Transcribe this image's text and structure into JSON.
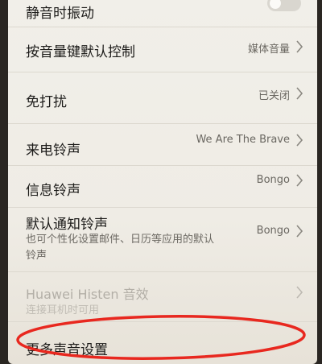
{
  "settings": {
    "vibrate_silent": {
      "title": "静音时振动"
    },
    "volume_key": {
      "title": "按音量键默认控制",
      "value": "媒体音量"
    },
    "dnd": {
      "title": "免打扰",
      "value": "已关闭"
    },
    "ringtone": {
      "title": "来电铃声",
      "value": "We Are The Brave"
    },
    "message_tone": {
      "title": "信息铃声",
      "value": "Bongo"
    },
    "notification_tone": {
      "title": "默认通知铃声",
      "sub_line1": "也可个性化设置邮件、日历等应用的默认",
      "sub_line2": "铃声",
      "value": "Bongo"
    },
    "histen": {
      "title": "Huawei Histen 音效",
      "sub": "连接耳机时可用"
    },
    "more_sound": {
      "title": "更多声音设置"
    }
  },
  "colors": {
    "highlight": "#e8281f"
  }
}
